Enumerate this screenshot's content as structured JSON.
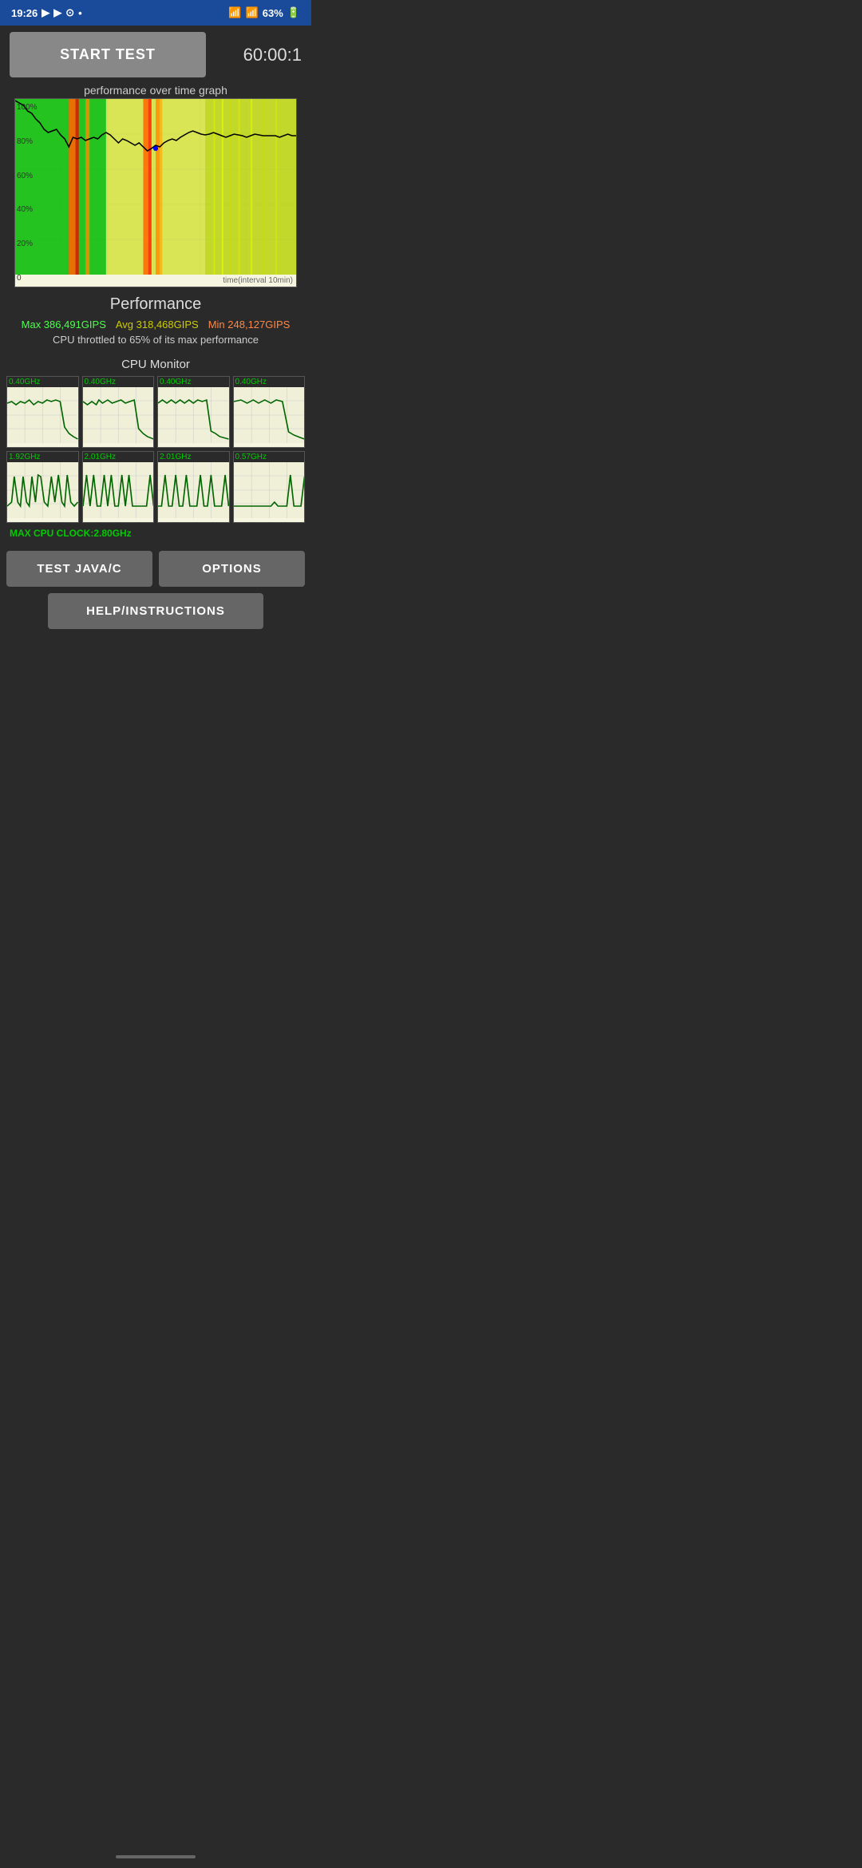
{
  "status_bar": {
    "time": "19:26",
    "battery": "63%",
    "icons": [
      "youtube",
      "youtube",
      "wifi",
      "dot"
    ]
  },
  "header": {
    "start_button_label": "START TEST",
    "timer": "60:00:1"
  },
  "graph": {
    "title": "performance over time graph",
    "y_labels": [
      "100%",
      "80%",
      "60%",
      "40%",
      "20%",
      "0"
    ],
    "time_label": "time(interval 10min)"
  },
  "performance": {
    "title": "Performance",
    "max_label": "Max 386,491GIPS",
    "avg_label": "Avg 318,468GIPS",
    "min_label": "Min 248,127GIPS",
    "throttle_text": "CPU throttled to 65% of its max performance"
  },
  "cpu_monitor": {
    "title": "CPU Monitor",
    "cores": [
      {
        "freq": "0.40GHz",
        "row": 0
      },
      {
        "freq": "0.40GHz",
        "row": 0
      },
      {
        "freq": "0.40GHz",
        "row": 0
      },
      {
        "freq": "0.40GHz",
        "row": 0
      },
      {
        "freq": "1.92GHz",
        "row": 1
      },
      {
        "freq": "2.01GHz",
        "row": 1
      },
      {
        "freq": "2.01GHz",
        "row": 1
      },
      {
        "freq": "0.57GHz",
        "row": 1
      }
    ],
    "max_clock": "MAX CPU CLOCK:2.80GHz"
  },
  "buttons": {
    "test_java": "TEST JAVA/C",
    "options": "OPTIONS",
    "help": "HELP/INSTRUCTIONS"
  }
}
